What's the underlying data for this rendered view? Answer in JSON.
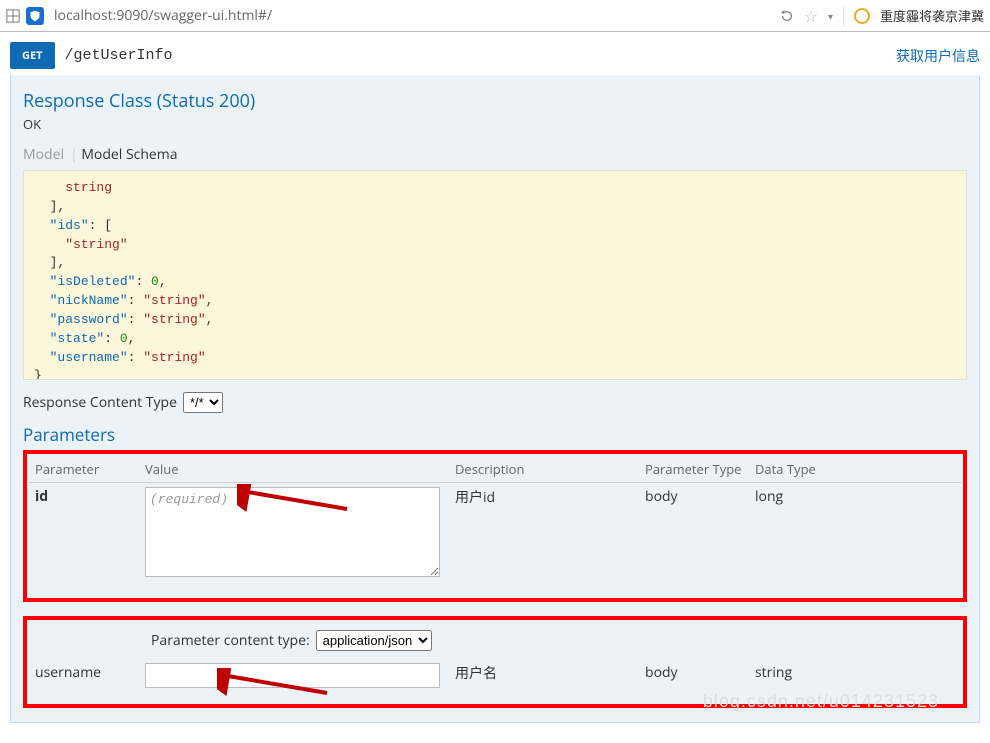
{
  "browser": {
    "url": "localhost:9090/swagger-ui.html#/",
    "sidebar_title": "重度霾将袭京津冀"
  },
  "operation": {
    "method": "GET",
    "path": "/getUserInfo",
    "description": "获取用户信息"
  },
  "response": {
    "title": "Response Class (Status 200)",
    "status_text": "OK",
    "tab_model": "Model",
    "tab_schema": "Model Schema",
    "content_type_label": "Response Content Type",
    "content_type_value": "*/*"
  },
  "schema_lines": [
    {
      "indent": 2,
      "parts": [
        {
          "t": "s",
          "v": "string"
        }
      ]
    },
    {
      "indent": 1,
      "parts": [
        {
          "t": "p",
          "v": "],"
        }
      ]
    },
    {
      "indent": 1,
      "parts": [
        {
          "t": "k",
          "v": "\"ids\""
        },
        {
          "t": "p",
          "v": ": ["
        }
      ]
    },
    {
      "indent": 2,
      "parts": [
        {
          "t": "s",
          "v": "\"string\""
        }
      ]
    },
    {
      "indent": 1,
      "parts": [
        {
          "t": "p",
          "v": "],"
        }
      ]
    },
    {
      "indent": 1,
      "parts": [
        {
          "t": "k",
          "v": "\"isDeleted\""
        },
        {
          "t": "p",
          "v": ": "
        },
        {
          "t": "n",
          "v": "0"
        },
        {
          "t": "p",
          "v": ","
        }
      ]
    },
    {
      "indent": 1,
      "parts": [
        {
          "t": "k",
          "v": "\"nickName\""
        },
        {
          "t": "p",
          "v": ": "
        },
        {
          "t": "s",
          "v": "\"string\""
        },
        {
          "t": "p",
          "v": ","
        }
      ]
    },
    {
      "indent": 1,
      "parts": [
        {
          "t": "k",
          "v": "\"password\""
        },
        {
          "t": "p",
          "v": ": "
        },
        {
          "t": "s",
          "v": "\"string\""
        },
        {
          "t": "p",
          "v": ","
        }
      ]
    },
    {
      "indent": 1,
      "parts": [
        {
          "t": "k",
          "v": "\"state\""
        },
        {
          "t": "p",
          "v": ": "
        },
        {
          "t": "n",
          "v": "0"
        },
        {
          "t": "p",
          "v": ","
        }
      ]
    },
    {
      "indent": 1,
      "parts": [
        {
          "t": "k",
          "v": "\"username\""
        },
        {
          "t": "p",
          "v": ": "
        },
        {
          "t": "s",
          "v": "\"string\""
        }
      ]
    },
    {
      "indent": 0,
      "parts": [
        {
          "t": "p",
          "v": "}"
        }
      ]
    }
  ],
  "parameters": {
    "title": "Parameters",
    "headers": {
      "param": "Parameter",
      "value": "Value",
      "desc": "Description",
      "ptype": "Parameter Type",
      "dtype": "Data Type"
    },
    "row1": {
      "name": "id",
      "placeholder": "(required)",
      "desc": "用户id",
      "ptype": "body",
      "dtype": "long"
    },
    "content_type_label": "Parameter content type:",
    "content_type_value": "application/json",
    "row2": {
      "name": "username",
      "placeholder": "",
      "desc": "用户名",
      "ptype": "body",
      "dtype": "string"
    }
  },
  "watermark": "blog.csdn.net/u014231523"
}
